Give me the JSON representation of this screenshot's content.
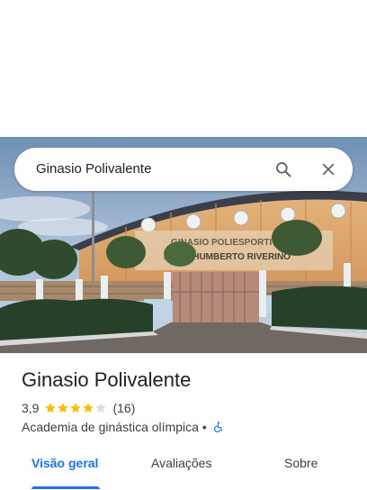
{
  "search": {
    "query": "Ginasio Polivalente"
  },
  "photo": {
    "sign_line1": "GINASIO POLIESPORTIVO",
    "sign_line2": "PROF. HUMBERTO RIVERINO"
  },
  "place": {
    "title": "Ginasio Polivalente",
    "rating": "3,9",
    "stars_filled": 3.9,
    "reviews": "(16)",
    "category": "Academia de ginástica olímpica",
    "separator": "•"
  },
  "tabs": [
    {
      "label": "Visão geral",
      "active": true
    },
    {
      "label": "Avaliações",
      "active": false
    },
    {
      "label": "Sobre",
      "active": false
    }
  ],
  "colors": {
    "accent": "#1a73e8",
    "star": "#fbbc04",
    "star_empty": "#dadce0"
  },
  "icons": [
    "search-icon",
    "close-icon",
    "star-icon",
    "wheelchair-icon"
  ]
}
